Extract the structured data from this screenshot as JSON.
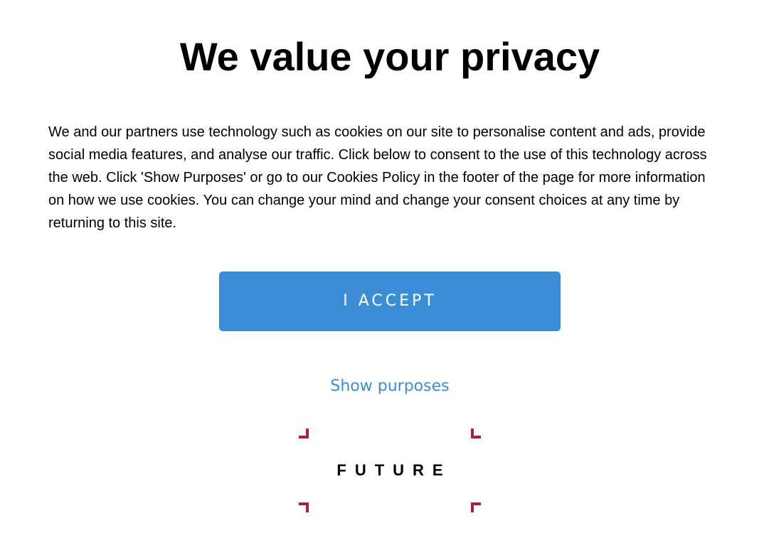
{
  "dialog": {
    "title": "We value your privacy",
    "body": "We and our partners use technology such as cookies on our site to personalise content and ads, provide social media features, and analyse our traffic. Click below to consent to the use of this technology across the web. Click 'Show Purposes' or go to our Cookies Policy in the footer of the page for more information on how we use cookies. You can change your mind and change your consent choices at any time by returning to this site.",
    "accept_label": "I ACCEPT",
    "purposes_label": "Show purposes"
  },
  "logo": {
    "text": "FUTURE"
  },
  "colors": {
    "accent": "#3b8ed6",
    "logo_corner": "#a6213c",
    "text": "#000000",
    "background": "#ffffff"
  }
}
